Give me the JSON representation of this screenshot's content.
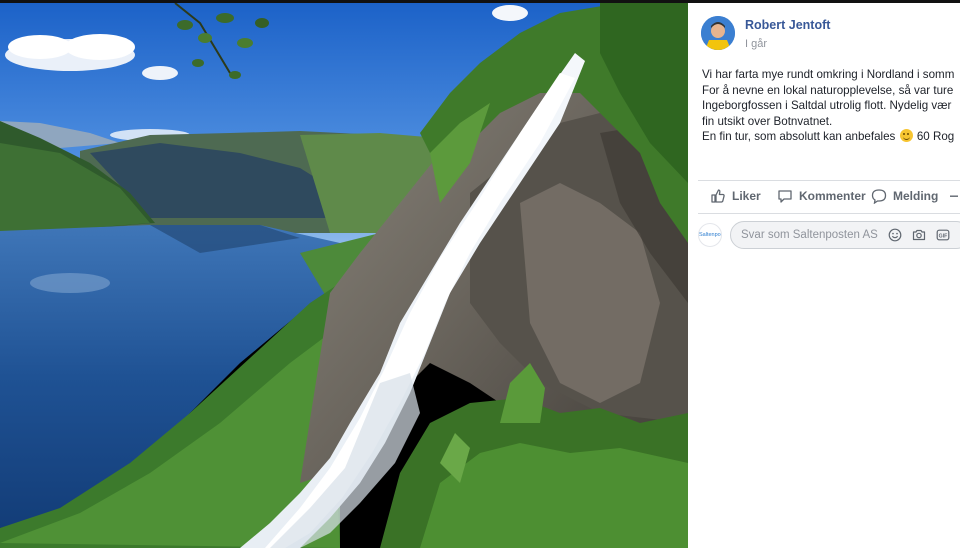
{
  "post": {
    "author": "Robert Jentoft",
    "time": "I går",
    "text_lines": [
      "Vi har farta mye rundt omkring i Nordland i somm",
      "For å nevne en lokal naturopplevelse, så var ture",
      "Ingeborgfossen i Saltdal utrolig flott. Nydelig vær",
      "fin utsikt over Botnvatnet."
    ],
    "last_line_text": "En fin tur, som absolutt kan anbefales",
    "last_line_count": "60 Rog",
    "avatar_icon": "person-avatar"
  },
  "actions": {
    "like": "Liker",
    "comment": "Kommenter",
    "message": "Melding"
  },
  "comment_box": {
    "placeholder": "Svar som Saltenposten AS",
    "page_avatar_text": "Saltenposten",
    "icons": [
      "emoji-icon",
      "camera-icon",
      "gif-icon"
    ]
  },
  "photo": {
    "description_icon": "waterfall-photo"
  }
}
